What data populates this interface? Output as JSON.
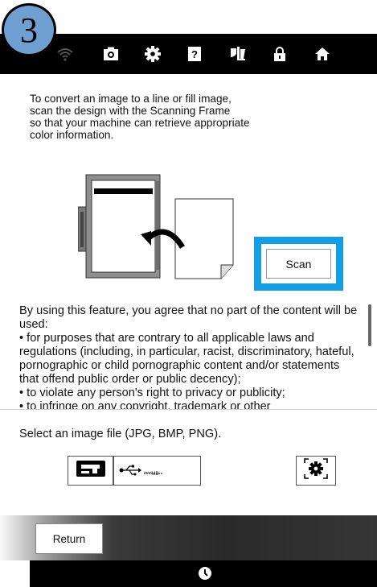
{
  "step_badge": "3",
  "top_bar": {
    "icons": [
      "wifi-icon",
      "camera-icon",
      "gear-icon",
      "help-icon",
      "sewing-foot-icon",
      "lock-icon",
      "home-icon"
    ]
  },
  "intro_text": "To convert an image to a line or fill image,\nscan the design with the Scanning Frame\nso that your machine can retrieve appropriate\ncolor information.",
  "scan_button_label": "Scan",
  "terms": {
    "paragraph": "By using this feature, you agree that no part of the content will be used:",
    "bullets": [
      "• for purposes that are contrary to all applicable laws and regulations (including, in particular, racist, discriminatory, hateful, pornographic or child pornographic content and/or statements that offend public order or public decency);",
      "• to violate any person's right to privacy or publicity;",
      "• to infringe on any copyright, trademark or other"
    ]
  },
  "select_label": "Select an image file (JPG, BMP, PNG).",
  "usb_button": {
    "mb_text": "****MB"
  },
  "return_label": "Return",
  "colors": {
    "accent": "#149ee6",
    "badge": "#6f9fd0",
    "bar": "#000000"
  }
}
